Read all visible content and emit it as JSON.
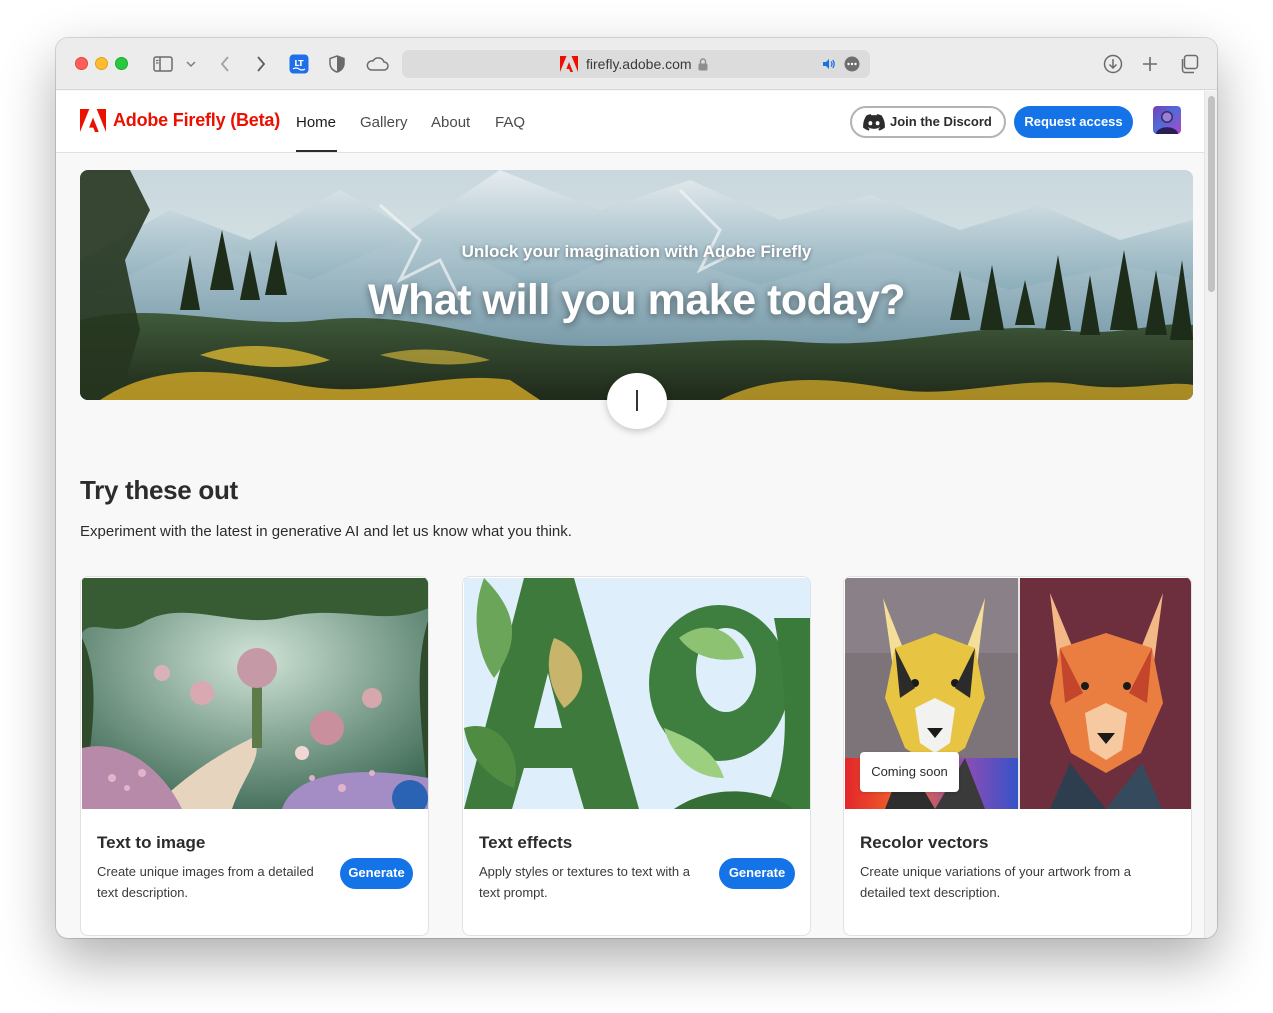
{
  "browser": {
    "url": "firefly.adobe.com",
    "icons": [
      "sidebar-toggle-icon",
      "chevron-down-icon",
      "back-icon",
      "forward-icon",
      "translate-extension-icon",
      "shield-icon",
      "cloud-icon",
      "adobe-site-icon",
      "lock-icon",
      "audio-icon",
      "more-icon",
      "download-icon",
      "new-tab-icon",
      "tabs-overview-icon"
    ]
  },
  "nav": {
    "brand": "Adobe Firefly (Beta)",
    "links": [
      {
        "label": "Home",
        "active": true
      },
      {
        "label": "Gallery",
        "active": false
      },
      {
        "label": "About",
        "active": false
      },
      {
        "label": "FAQ",
        "active": false
      }
    ],
    "discord_button": "Join the Discord",
    "request_button": "Request access"
  },
  "hero": {
    "subtitle": "Unlock your imagination with Adobe Firefly",
    "title": "What will you make today?",
    "prompt_cursor": "|"
  },
  "section": {
    "title": "Try these out",
    "description": "Experiment with the latest in generative AI and let us know what you think."
  },
  "cards": [
    {
      "title": "Text to image",
      "description": "Create unique images from a detailed text description.",
      "button": "Generate"
    },
    {
      "title": "Text effects",
      "description": "Apply styles or textures to text with a text prompt.",
      "button": "Generate"
    },
    {
      "title": "Recolor vectors",
      "description": "Create unique variations of your artwork from a detailed text description.",
      "badge": "Coming soon"
    }
  ],
  "colors": {
    "adobe_red": "#eb1000",
    "primary_blue": "#1473e6",
    "text_dark": "#2c2c2c",
    "page_bg": "#f8f8f8"
  }
}
